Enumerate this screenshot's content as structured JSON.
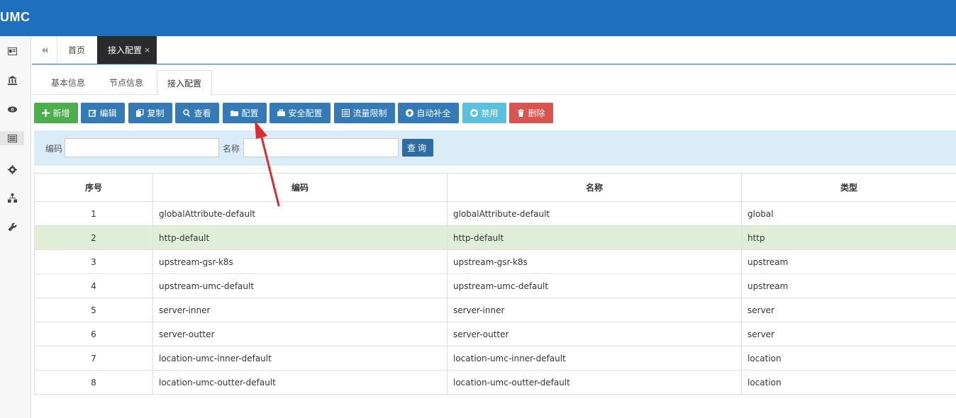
{
  "app": {
    "logo": "UMC"
  },
  "sidebar": {
    "items": [
      {
        "icon": "id-card-icon"
      },
      {
        "icon": "bank-icon"
      },
      {
        "icon": "eye-icon"
      },
      {
        "icon": "list-icon"
      },
      {
        "icon": "gear-icon"
      },
      {
        "icon": "sitemap-icon"
      },
      {
        "icon": "wrench-icon"
      }
    ]
  },
  "tabs": {
    "home": "首页",
    "active": "接入配置",
    "close": "×"
  },
  "subtabs": [
    "基本信息",
    "节点信息",
    "接入配置"
  ],
  "toolbar": {
    "add": "新增",
    "edit": "编辑",
    "copy": "复制",
    "view": "查看",
    "config": "配置",
    "security": "安全配置",
    "ratelimit": "流量限制",
    "autofill": "自动补全",
    "disable": "禁用",
    "delete": "删除"
  },
  "search": {
    "code_label": "编码",
    "name_label": "名称",
    "button": "查询"
  },
  "table": {
    "headers": [
      "序号",
      "编码",
      "名称",
      "类型"
    ],
    "rows": [
      {
        "idx": "1",
        "code": "globalAttribute-default",
        "name": "globalAttribute-default",
        "type": "global"
      },
      {
        "idx": "2",
        "code": "http-default",
        "name": "http-default",
        "type": "http"
      },
      {
        "idx": "3",
        "code": "upstream-gsr-k8s",
        "name": "upstream-gsr-k8s",
        "type": "upstream"
      },
      {
        "idx": "4",
        "code": "upstream-umc-default",
        "name": "upstream-umc-default",
        "type": "upstream"
      },
      {
        "idx": "5",
        "code": "server-inner",
        "name": "server-inner",
        "type": "server"
      },
      {
        "idx": "6",
        "code": "server-outter",
        "name": "server-outter",
        "type": "server"
      },
      {
        "idx": "7",
        "code": "location-umc-inner-default",
        "name": "location-umc-inner-default",
        "type": "location"
      },
      {
        "idx": "8",
        "code": "location-umc-outter-default",
        "name": "location-umc-outter-default",
        "type": "location"
      }
    ],
    "selected_row": 2
  },
  "colors": {
    "header_blue": "#1e6fbd",
    "annotation_arrow": "#e02b2b"
  }
}
